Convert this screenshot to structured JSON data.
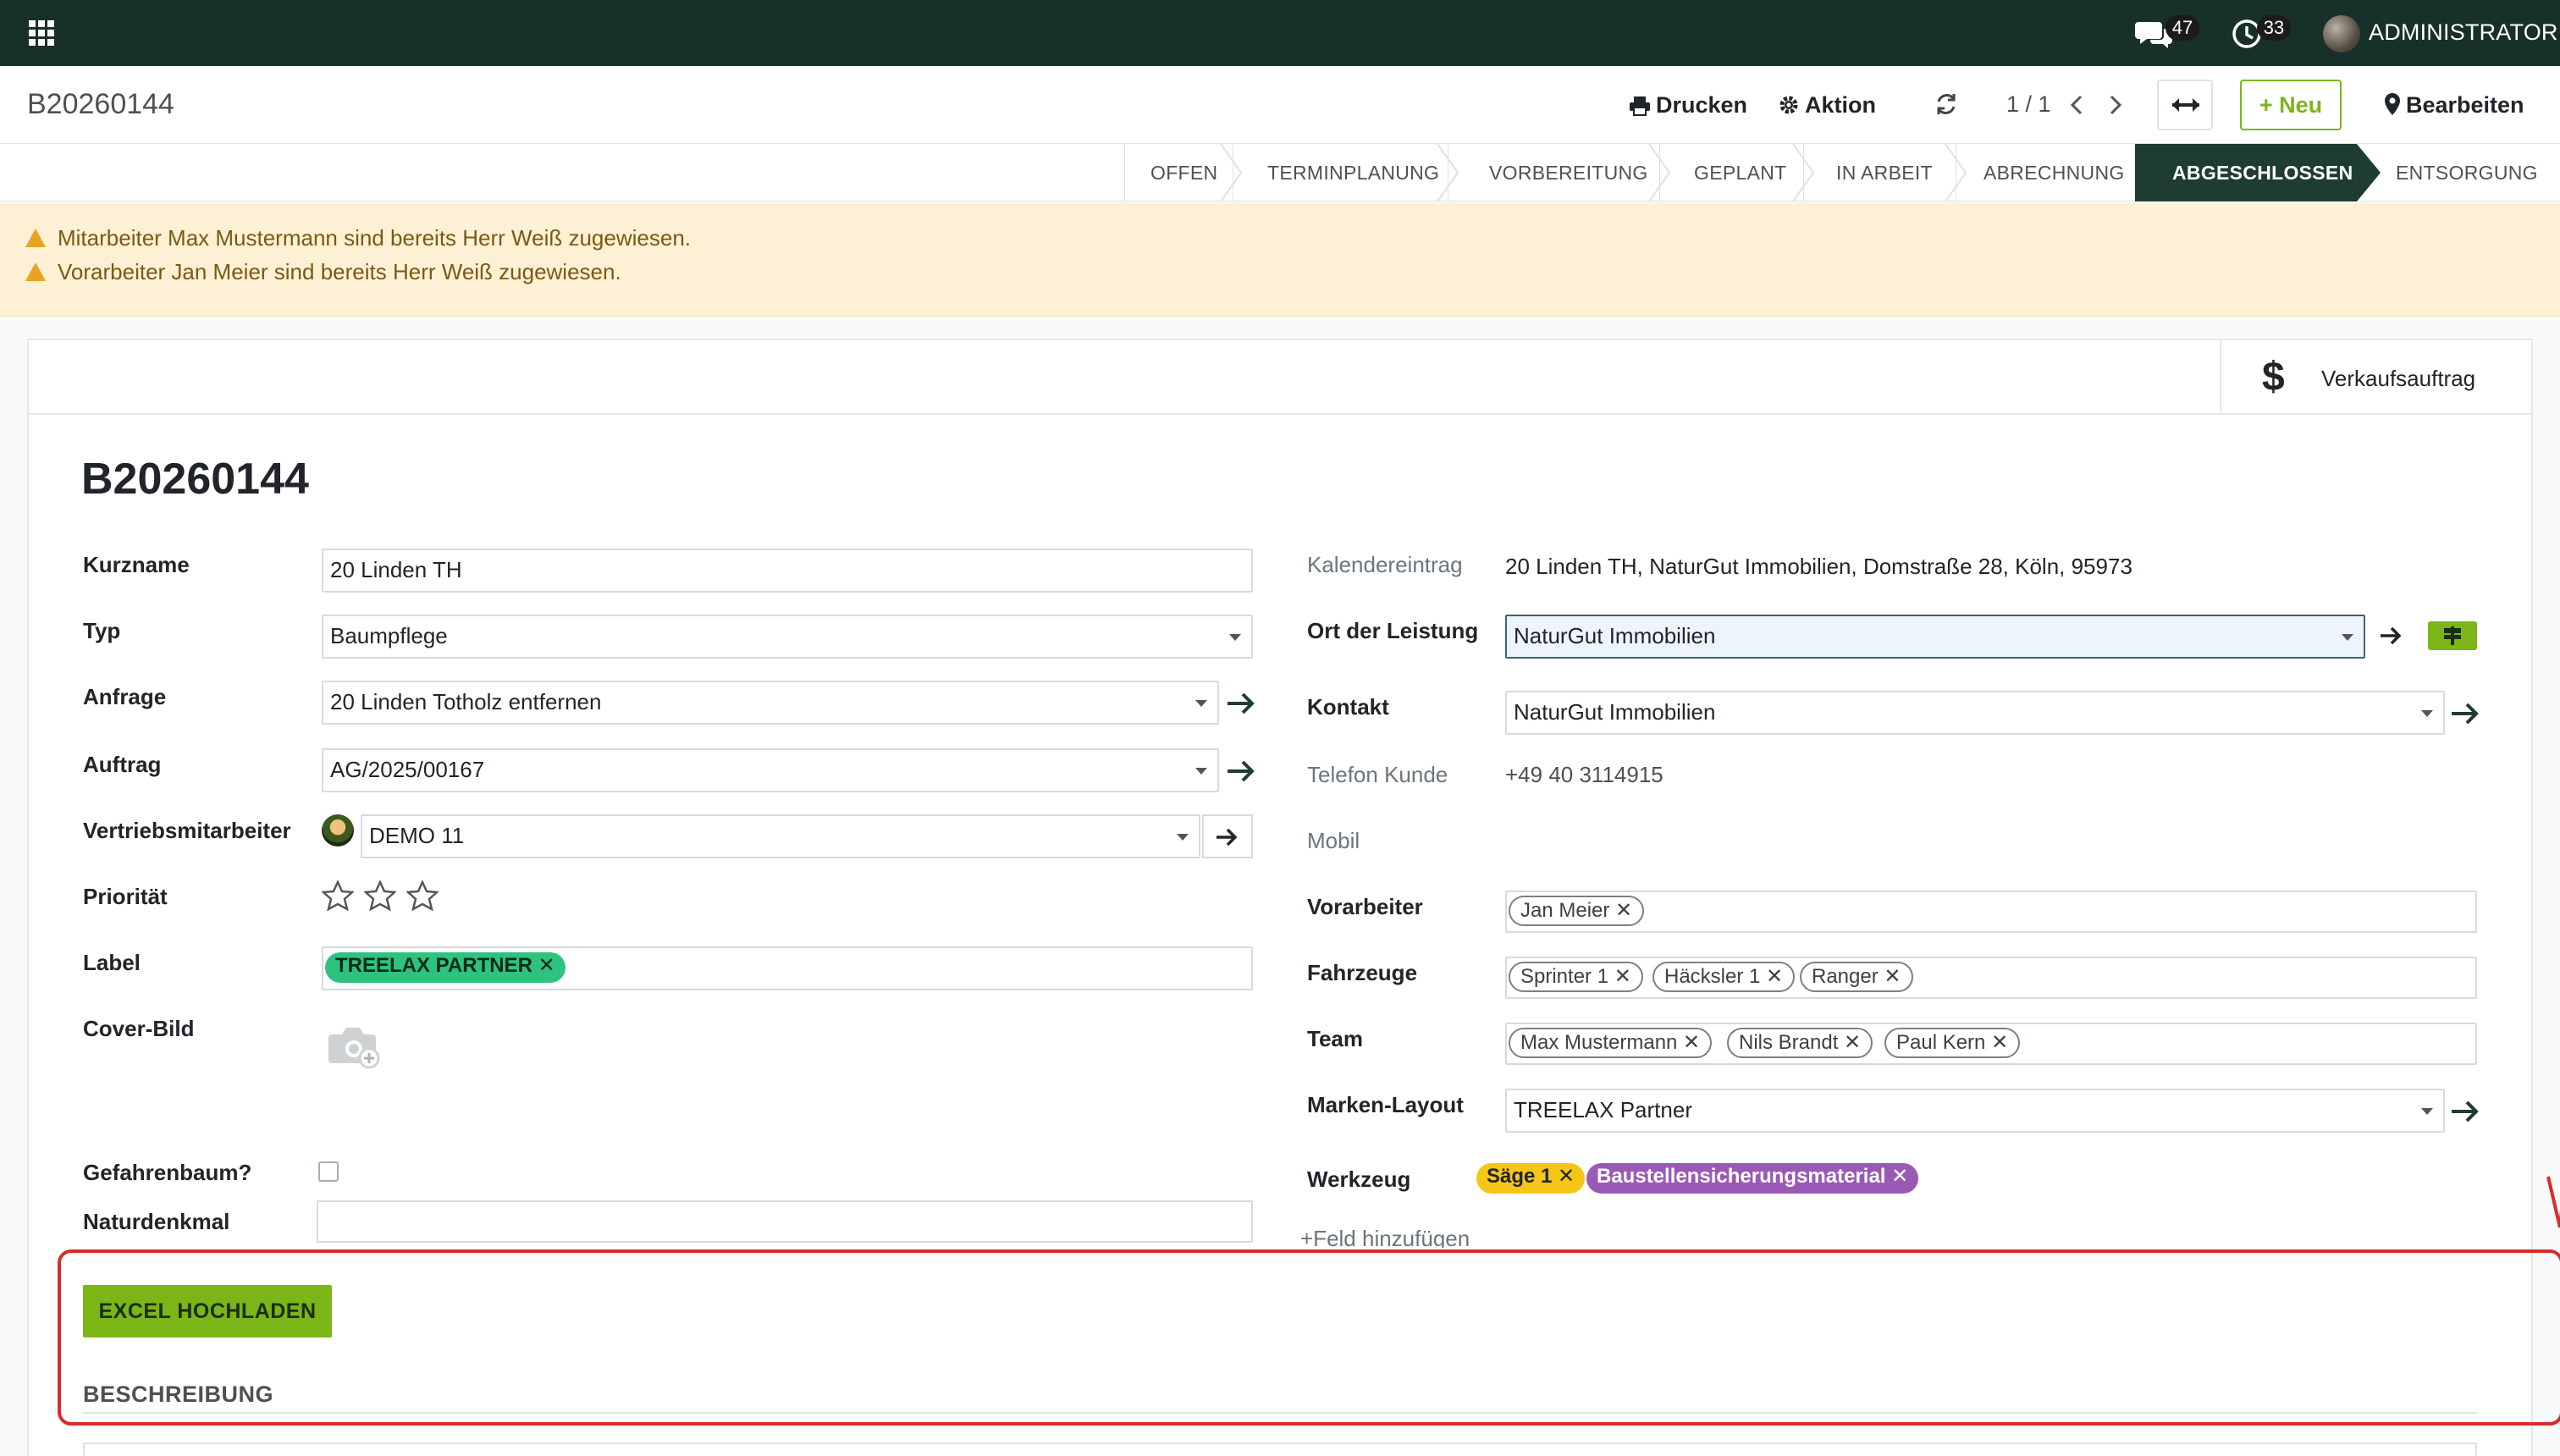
{
  "navbar": {
    "chat_count": "47",
    "activity_count": "33",
    "user_name": "ADMINISTRATOR"
  },
  "control": {
    "breadcrumb": "B20260144",
    "print_label": "Drucken",
    "action_label": "Aktion",
    "pager": "1 / 1",
    "new_label": "Neu",
    "edit_label": "Bearbeiten"
  },
  "stages": [
    {
      "label": "OFFEN",
      "active": false
    },
    {
      "label": "TERMINPLANUNG",
      "active": false
    },
    {
      "label": "VORBEREITUNG",
      "active": false
    },
    {
      "label": "GEPLANT",
      "active": false
    },
    {
      "label": "IN ARBEIT",
      "active": false
    },
    {
      "label": "ABRECHNUNG",
      "active": false
    },
    {
      "label": "ABGESCHLOSSEN",
      "active": true
    },
    {
      "label": "ENTSORGUNG",
      "active": false
    }
  ],
  "warnings": [
    "Mitarbeiter Max Mustermann sind bereits Herr Weiß zugewiesen.",
    "Vorarbeiter Jan Meier sind bereits Herr Weiß zugewiesen."
  ],
  "smart_button": {
    "label": "Verkaufsauftrag",
    "icon": "dollar-icon"
  },
  "record": {
    "title": "B20260144",
    "left": {
      "kurzname_label": "Kurzname",
      "kurzname": "20 Linden TH",
      "typ_label": "Typ",
      "typ": "Baumpflege",
      "anfrage_label": "Anfrage",
      "anfrage": "20 Linden Totholz entfernen",
      "auftrag_label": "Auftrag",
      "auftrag": "AG/2025/00167",
      "vertrieb_label": "Vertriebsmitarbeiter",
      "vertrieb": "DEMO 11",
      "prioritaet_label": "Priorität",
      "prioritaet": 0,
      "label_label": "Label",
      "label_tag": "TREELAX PARTNER",
      "cover_label": "Cover-Bild",
      "gefahrenbaum_label": "Gefahrenbaum?",
      "naturdenkmal_label": "Naturdenkmal",
      "naturdenkmal": ""
    },
    "right": {
      "kalender_label": "Kalendereintrag",
      "kalender": "20 Linden TH, NaturGut Immobilien, Domstraße 28, Köln, 95973",
      "ort_label": "Ort der Leistung",
      "ort": "NaturGut Immobilien",
      "kontakt_label": "Kontakt",
      "kontakt": "NaturGut Immobilien",
      "telefon_label": "Telefon Kunde",
      "telefon": "+49 40 3114915",
      "mobil_label": "Mobil",
      "vorarbeiter_label": "Vorarbeiter",
      "vorarbeiter": [
        "Jan Meier"
      ],
      "fahrzeuge_label": "Fahrzeuge",
      "fahrzeuge": [
        "Sprinter 1",
        "Häcksler 1",
        "Ranger"
      ],
      "team_label": "Team",
      "team": [
        "Max Mustermann",
        "Nils Brandt",
        "Paul Kern"
      ],
      "marken_label": "Marken-Layout",
      "marken": "TREELAX Partner",
      "werkzeug_label": "Werkzeug",
      "werkzeug": [
        "Säge 1",
        "Baustellensicherungsmaterial"
      ],
      "add_field": "+Feld hinzufügen"
    }
  },
  "excel_button": "EXCEL HOCHLADEN",
  "section_title": "BESCHREIBUNG",
  "colors": {
    "navbar": "#17302a",
    "accent": "#7cb518",
    "active_stage": "#1f3c34",
    "annotation": "#d92b2b"
  }
}
